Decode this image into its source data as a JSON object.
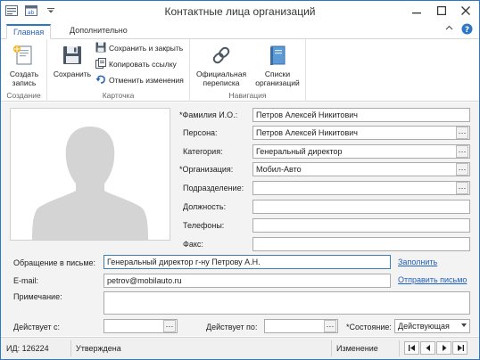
{
  "window": {
    "title": "Контактные лица организаций"
  },
  "ribbon": {
    "tabs": [
      {
        "label": "Главная"
      },
      {
        "label": "Дополнительно"
      }
    ],
    "groups": {
      "create": {
        "name": "Создание",
        "create_label_1": "Создать",
        "create_label_2": "запись"
      },
      "card": {
        "name": "Карточка",
        "save_label": "Сохранить",
        "save_close_label": "Сохранить и закрыть",
        "copy_link_label": "Копировать ссылку",
        "undo_label": "Отменить изменения"
      },
      "navigation": {
        "name": "Навигация",
        "official_1": "Официальная",
        "official_2": "переписка",
        "lists_1": "Списки",
        "lists_2": "организаций"
      }
    }
  },
  "form": {
    "surname_label": "*Фамилия И.О.:",
    "surname_value": "Петров Алексей Никитович",
    "person_label": "Персона:",
    "person_value": "Петров Алексей Никитович",
    "category_label": "Категория:",
    "category_value": "Генеральный директор",
    "organization_label": "*Организация:",
    "organization_value": "Мобил-Авто",
    "department_label": "Подразделение:",
    "department_value": "",
    "position_label": "Должность:",
    "position_value": "",
    "phones_label": "Телефоны:",
    "phones_value": "",
    "fax_label": "Факс:",
    "fax_value": "",
    "salutation_label": "Обращение в письме:",
    "salutation_value": "Генеральный директор г-ну Петрову А.Н.",
    "fill_link": "Заполнить",
    "email_label": "E-mail:",
    "email_value": "petrov@mobilauto.ru",
    "send_letter_link": "Отправить письмо",
    "note_label": "Примечание:",
    "note_value": "",
    "valid_from_label": "Действует с:",
    "valid_from_value": "",
    "valid_to_label": "Действует по:",
    "valid_to_value": "",
    "state_label": "*Состояние:",
    "state_value": "Действующая"
  },
  "statusbar": {
    "id_text": "ИД: 126224",
    "status_text": "Утверждена",
    "mode_text": "Изменение"
  }
}
